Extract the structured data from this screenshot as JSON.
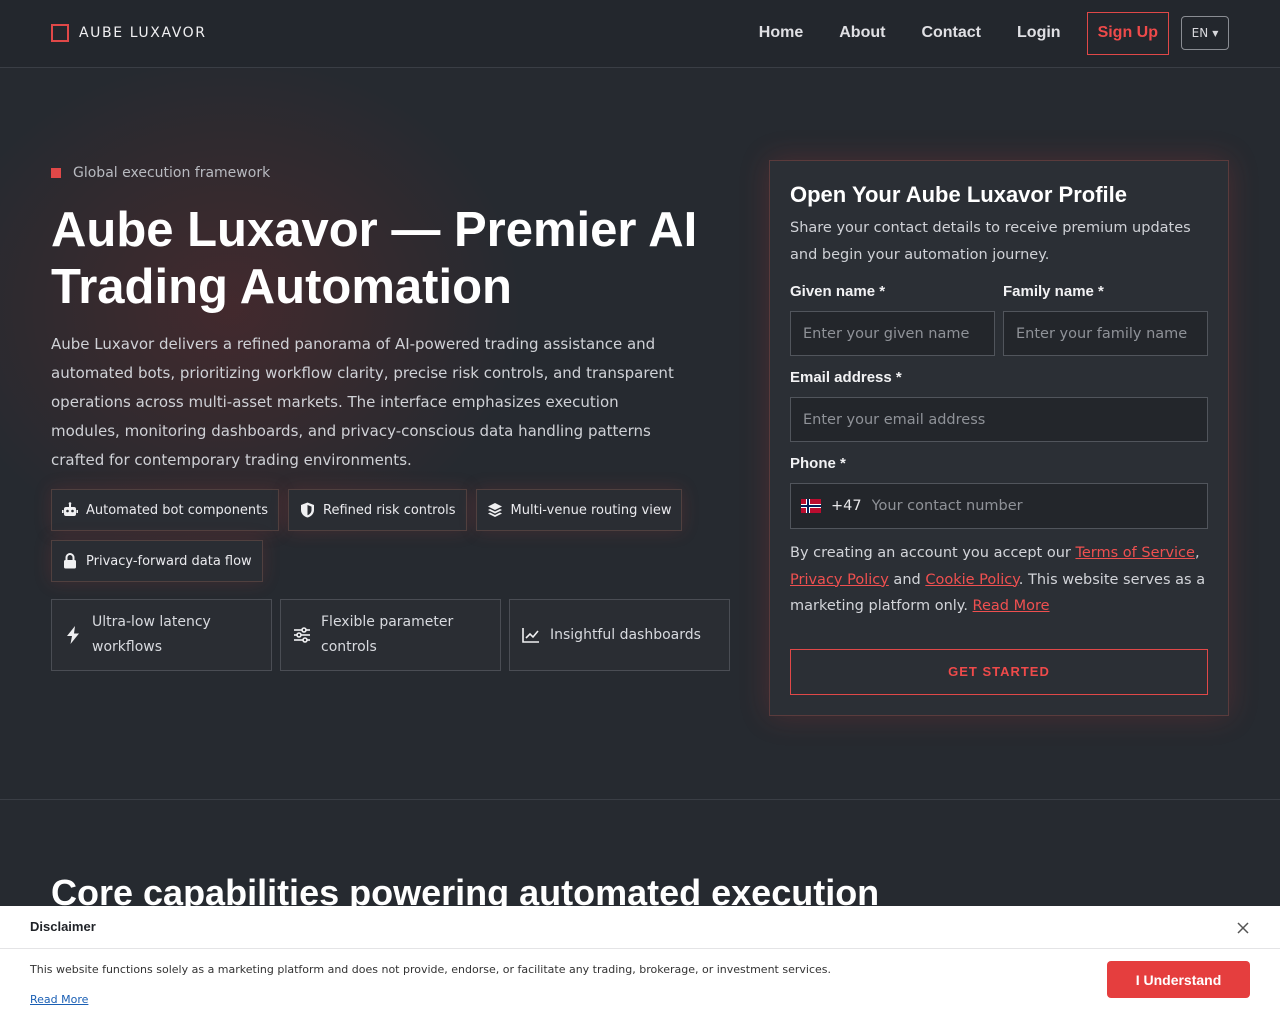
{
  "brand": {
    "name": "AUBE LUXAVOR",
    "accent": "#e04848"
  },
  "nav": {
    "items": [
      "Home",
      "About",
      "Contact",
      "Login"
    ],
    "signup": "Sign Up",
    "language": "EN"
  },
  "hero": {
    "eyebrow": "Global execution framework",
    "title": "Aube Luxavor — Premier AI Trading Automation",
    "description": "Aube Luxavor delivers a refined panorama of AI-powered trading assistance and automated bots, prioritizing workflow clarity, precise risk controls, and transparent operations across multi-asset markets. The interface emphasizes execution modules, monitoring dashboards, and privacy-conscious data handling patterns crafted for contemporary trading environments.",
    "chips": [
      {
        "icon": "robot-icon",
        "label": "Automated bot components"
      },
      {
        "icon": "shield-icon",
        "label": "Refined risk controls"
      },
      {
        "icon": "layers-icon",
        "label": "Multi-venue routing view"
      },
      {
        "icon": "lock-icon",
        "label": "Privacy-forward data flow"
      }
    ],
    "features": [
      {
        "icon": "lightning-icon",
        "label": "Ultra-low latency workflows"
      },
      {
        "icon": "sliders-icon",
        "label": "Flexible parameter controls"
      },
      {
        "icon": "line-chart-icon",
        "label": "Insightful dashboards"
      }
    ]
  },
  "form": {
    "title": "Open Your Aube Luxavor Profile",
    "subtitle": "Share your contact details to receive premium updates and begin your automation journey.",
    "given_label": "Given name *",
    "given_placeholder": "Enter your given name",
    "family_label": "Family name *",
    "family_placeholder": "Enter your family name",
    "email_label": "Email address *",
    "email_placeholder": "Enter your email address",
    "phone_label": "Phone *",
    "phone_flag": "norway-flag-icon",
    "phone_code": "+47",
    "phone_placeholder": "Your contact number",
    "consent_prefix": "By creating an account you accept our ",
    "terms": "Terms of Service",
    "comma": ",",
    "privacy": "Privacy Policy",
    "and": " and ",
    "cookie": "Cookie Policy",
    "consent_suffix": ". This website serves as a marketing platform only. ",
    "read_more": "Read More",
    "submit": "GET STARTED"
  },
  "section": {
    "title": "Core capabilities powering automated execution"
  },
  "disclaimer": {
    "title": "Disclaimer",
    "text": "This website functions solely as a marketing platform and does not provide, endorse, or facilitate any trading, brokerage, or investment services.",
    "read_more": "Read More",
    "button": "I Understand"
  }
}
